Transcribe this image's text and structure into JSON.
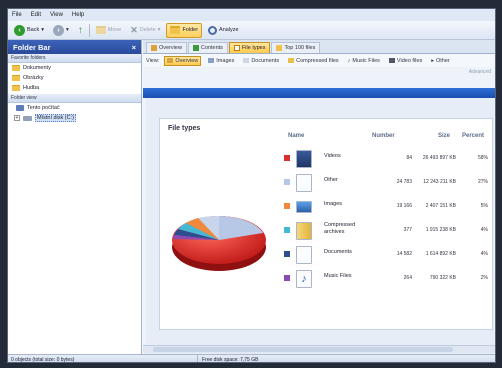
{
  "menu": [
    "File",
    "Edit",
    "View",
    "Help"
  ],
  "toolbar": {
    "back": "Back",
    "move": "Move",
    "delete": "Delete",
    "folder": "Folder",
    "analyze": "Analyze"
  },
  "sidebar": {
    "title": "Folder Bar",
    "close": "×",
    "favorites_header": "Favorite folders",
    "favorites": [
      "Dokumenty",
      "Obrázky",
      "Hudba"
    ],
    "folderview_header": "Folder view",
    "tree": [
      {
        "label": "Tento počítač"
      },
      {
        "label": "Místní disk (C:)"
      }
    ]
  },
  "tabs": [
    "Overview",
    "Contents",
    "File types",
    "Top 100 files"
  ],
  "viewbar": {
    "label": "View:",
    "buttons": [
      "Overview",
      "Images",
      "Documents",
      "Compressed files",
      "Music Files",
      "Video files",
      "Other"
    ],
    "advanced": "Advanced"
  },
  "panel": {
    "title": "File types",
    "columns": [
      "Name",
      "Number",
      "Size",
      "Percent"
    ],
    "rows": [
      {
        "name": "Videos",
        "number": "84",
        "size": "26 493 897 KB",
        "percent": "58%",
        "color": "#d93030"
      },
      {
        "name": "Other",
        "number": "24 783",
        "size": "12 243 211 KB",
        "percent": "27%",
        "color": "#b7c7e6"
      },
      {
        "name": "Images",
        "number": "19 166",
        "size": "2 407 151 KB",
        "percent": "5%",
        "color": "#ef8a3c"
      },
      {
        "name": "Compressed archives",
        "number": "377",
        "size": "1 915 238 KB",
        "percent": "4%",
        "color": "#45b8d6"
      },
      {
        "name": "Documents",
        "number": "14 582",
        "size": "1 614 892 KB",
        "percent": "4%",
        "color": "#2e4f8f"
      },
      {
        "name": "Music Files",
        "number": "264",
        "size": "790 322 KB",
        "percent": "2%",
        "color": "#8a4bb5"
      }
    ]
  },
  "status": {
    "left": "0 objects (total size: 0 bytes)",
    "right": "Free disk space: 7,75 GB"
  }
}
